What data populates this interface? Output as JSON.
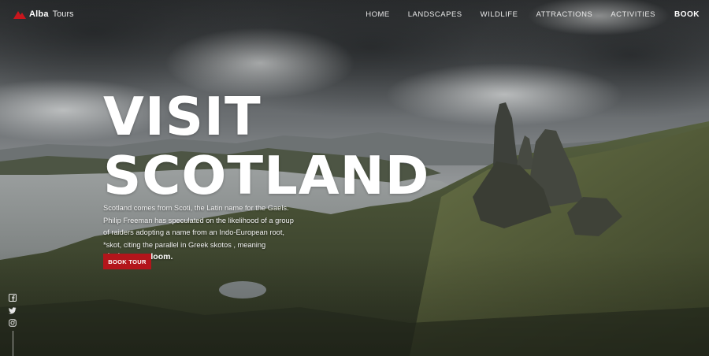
{
  "brand": {
    "name_bold": "Alba",
    "name_light": "Tours",
    "accent": "#c8161d"
  },
  "nav": {
    "items": [
      "HOME",
      "LANDSCAPES",
      "WILDLIFE",
      "ATTRACTIONS",
      "ACTIVITIES"
    ],
    "cta": "BOOK"
  },
  "hero": {
    "title_line1": "VISIT",
    "title_line2": "SCOTLAND",
    "description": "Scotland comes from Scoti, the Latin name for the Gaels. Philip Freeman has speculated on the likelihood of a group of raiders adopting a name from an Indo-European root, *skot, citing the parallel in Greek skotos , meaning",
    "description_emphasis": "darkness, gloom.",
    "button_label": "BOOK TOUR",
    "button_color": "#b3151b"
  },
  "social": {
    "icons": [
      "facebook-icon",
      "twitter-icon",
      "instagram-icon"
    ]
  }
}
